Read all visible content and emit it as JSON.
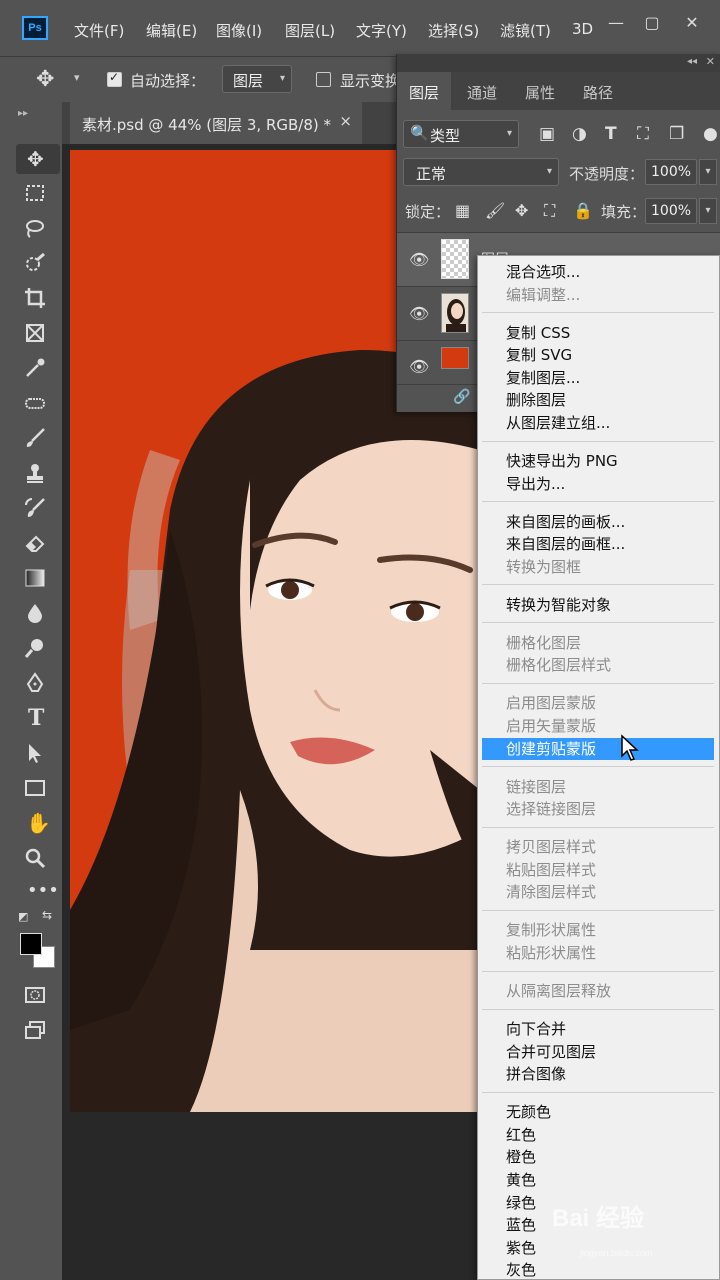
{
  "app": {
    "logo": "Ps"
  },
  "menubar": {
    "items": [
      "文件(F)",
      "编辑(E)",
      "图像(I)",
      "图层(L)",
      "文字(Y)",
      "选择(S)",
      "滤镜(T)",
      "3D"
    ],
    "window_controls": [
      "—",
      "▢",
      "✕"
    ]
  },
  "options": {
    "auto_select_label": "自动选择：",
    "auto_select_checked": true,
    "target_value": "图层",
    "show_transform_label": "显示变换"
  },
  "document": {
    "tab_title": "素材.psd @ 44% (图层 3, RGB/8) *",
    "close_glyph": "×",
    "background_color": "#d43a10"
  },
  "layers_panel": {
    "tabs": [
      "图层",
      "通道",
      "属性",
      "路径"
    ],
    "active_tab": "图层",
    "filter_value": "类型",
    "blend_mode": "正常",
    "opacity_label": "不透明度：",
    "opacity_value": "100%",
    "lock_label": "锁定：",
    "fill_label": "填充：",
    "fill_value": "100%",
    "layers": [
      {
        "name": "图层",
        "thumb": "transparent"
      },
      {
        "name": "",
        "thumb": "photo"
      },
      {
        "name": "",
        "thumb": "red"
      }
    ]
  },
  "context_menu": {
    "groups": [
      [
        {
          "label": "混合选项...",
          "enabled": true
        },
        {
          "label": "编辑调整...",
          "enabled": false
        }
      ],
      [
        {
          "label": "复制 CSS",
          "enabled": true
        },
        {
          "label": "复制 SVG",
          "enabled": true
        },
        {
          "label": "复制图层...",
          "enabled": true
        },
        {
          "label": "删除图层",
          "enabled": true
        },
        {
          "label": "从图层建立组...",
          "enabled": true
        }
      ],
      [
        {
          "label": "快速导出为 PNG",
          "enabled": true
        },
        {
          "label": "导出为...",
          "enabled": true
        }
      ],
      [
        {
          "label": "来自图层的画板...",
          "enabled": true
        },
        {
          "label": "来自图层的画框...",
          "enabled": true
        },
        {
          "label": "转换为图框",
          "enabled": false
        }
      ],
      [
        {
          "label": "转换为智能对象",
          "enabled": true
        }
      ],
      [
        {
          "label": "栅格化图层",
          "enabled": false
        },
        {
          "label": "栅格化图层样式",
          "enabled": false
        }
      ],
      [
        {
          "label": "启用图层蒙版",
          "enabled": false
        },
        {
          "label": "启用矢量蒙版",
          "enabled": false
        },
        {
          "label": "创建剪贴蒙版",
          "enabled": true,
          "highlight": true
        }
      ],
      [
        {
          "label": "链接图层",
          "enabled": false
        },
        {
          "label": "选择链接图层",
          "enabled": false
        }
      ],
      [
        {
          "label": "拷贝图层样式",
          "enabled": false
        },
        {
          "label": "粘贴图层样式",
          "enabled": false
        },
        {
          "label": "清除图层样式",
          "enabled": false
        }
      ],
      [
        {
          "label": "复制形状属性",
          "enabled": false
        },
        {
          "label": "粘贴形状属性",
          "enabled": false
        }
      ],
      [
        {
          "label": "从隔离图层释放",
          "enabled": false
        }
      ],
      [
        {
          "label": "向下合并",
          "enabled": true
        },
        {
          "label": "合并可见图层",
          "enabled": true
        },
        {
          "label": "拼合图像",
          "enabled": true
        }
      ],
      [
        {
          "label": "无颜色",
          "enabled": true
        },
        {
          "label": "红色",
          "enabled": true
        },
        {
          "label": "橙色",
          "enabled": true
        },
        {
          "label": "黄色",
          "enabled": true
        },
        {
          "label": "绿色",
          "enabled": true
        },
        {
          "label": "蓝色",
          "enabled": true
        },
        {
          "label": "紫色",
          "enabled": true
        },
        {
          "label": "灰色",
          "enabled": true
        }
      ]
    ]
  },
  "watermark": {
    "text": "Bai 经验",
    "sub": "jingyan.baidu.com"
  },
  "colors": {
    "ui_dark": "#535353",
    "highlight": "#3399ff",
    "canvas_red": "#d43a10"
  }
}
